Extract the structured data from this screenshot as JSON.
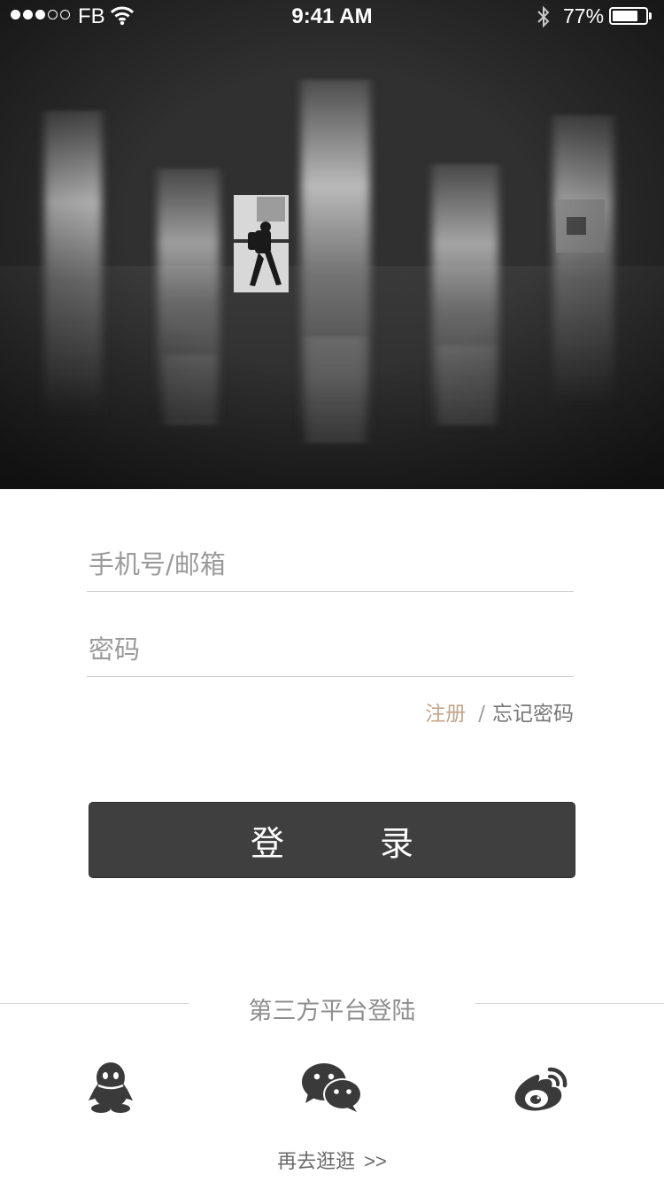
{
  "status_bar": {
    "carrier": "FB",
    "time": "9:41 AM",
    "battery_text": "77%",
    "battery_level": 0.77,
    "signal_bars": 3,
    "signal_total": 5
  },
  "colors": {
    "button_bg": "#3f3f3f",
    "register_link": "#c4a48a",
    "hero_bg": "#2f2f30"
  },
  "login_form": {
    "phone_placeholder": "手机号/邮箱",
    "password_placeholder": "密码",
    "register_label": "注册",
    "separator": "/",
    "forgot_label": "忘记密码",
    "login_button_label": "登录"
  },
  "third_party": {
    "title": "第三方平台登陆",
    "icons": [
      "qq-icon",
      "wechat-icon",
      "weibo-icon"
    ]
  },
  "browse": {
    "label": "再去逛逛",
    "arrow": ">>"
  }
}
